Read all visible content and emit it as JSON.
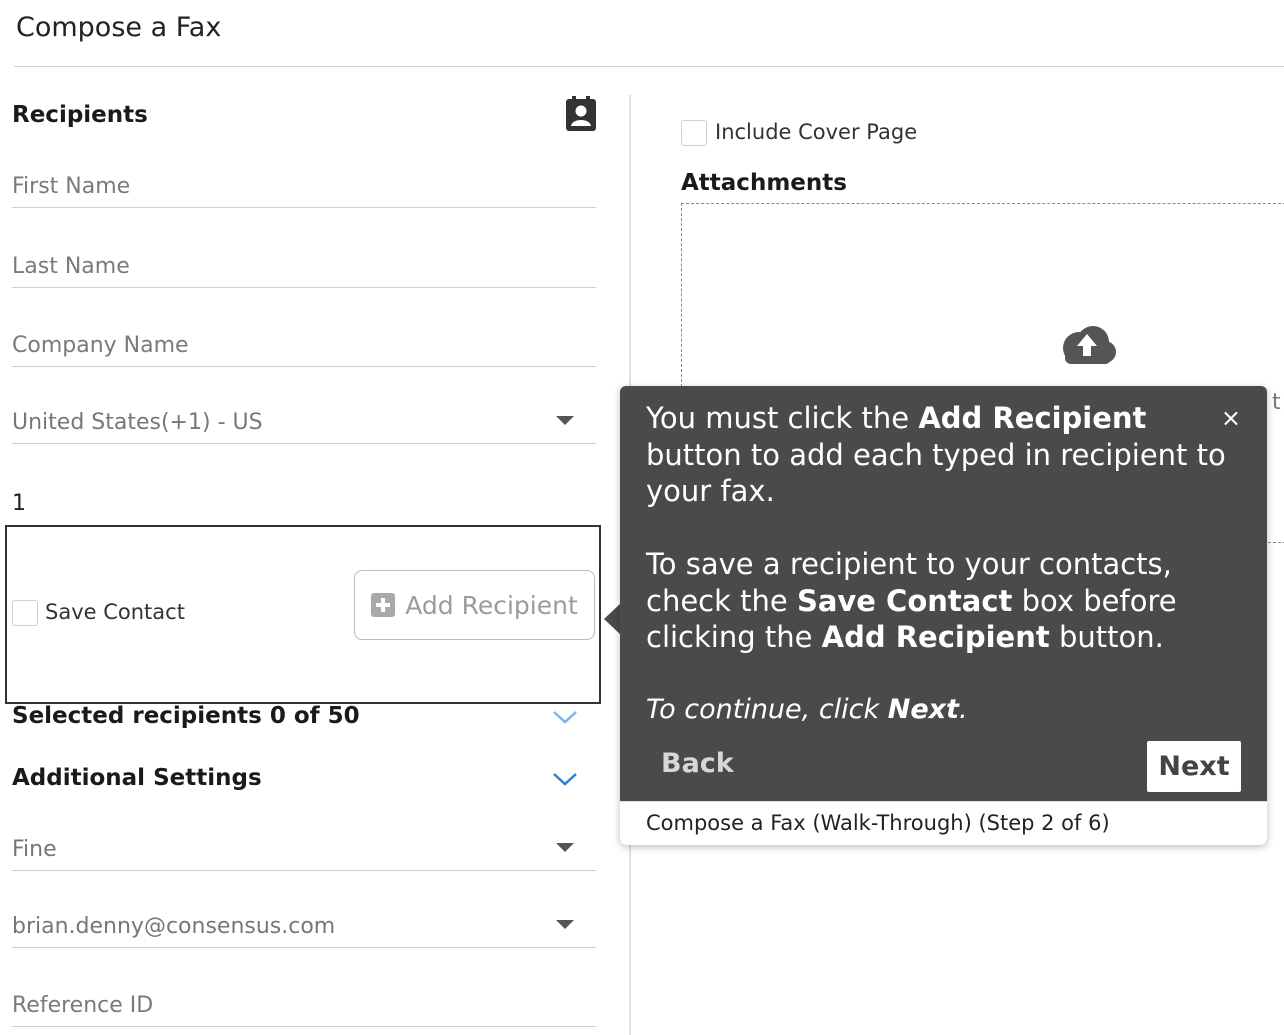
{
  "page": {
    "title": "Compose a Fax"
  },
  "recipients": {
    "heading": "Recipients",
    "contacts_icon": "contact-book-icon",
    "first_name_placeholder": "First Name",
    "last_name_placeholder": "Last Name",
    "company_name_placeholder": "Company Name",
    "country_value": "United States(+1) - US",
    "fax_number_value": "1",
    "save_contact_label": "Save Contact",
    "add_recipient_label": "Add Recipient",
    "selected_label": "Selected recipients 0 of 50"
  },
  "additional_settings": {
    "heading": "Additional Settings",
    "resolution_value": "Fine",
    "notify_email_value": "brian.denny@consensus.com",
    "reference_id_placeholder": "Reference ID"
  },
  "right_panel": {
    "cover_page_label": "Include Cover Page",
    "attachments_heading": "Attachments",
    "upload_icon": "cloud-upload-icon",
    "peek_text": "t"
  },
  "tour": {
    "p1_before": "You must click the ",
    "p1_bold": "Add Recipient",
    "p1_after": " button to add each typed in recipient to your fax.",
    "p2_before": "To save a recipient to your contacts, check the ",
    "p2_bold1": "Save Contact",
    "p2_mid": " box before clicking the ",
    "p2_bold2": "Add Recipient",
    "p2_after": " button.",
    "continue_before": "To continue, click ",
    "continue_bold": "Next",
    "continue_after": ".",
    "close_label": "×",
    "back_label": "Back",
    "next_label": "Next",
    "footer_label": "Compose a Fax (Walk-Through) (Step 2 of 6)"
  },
  "colors": {
    "accent": "#2f80d1",
    "popover_bg": "#4a4a4a",
    "highlight_border": "#333333"
  }
}
